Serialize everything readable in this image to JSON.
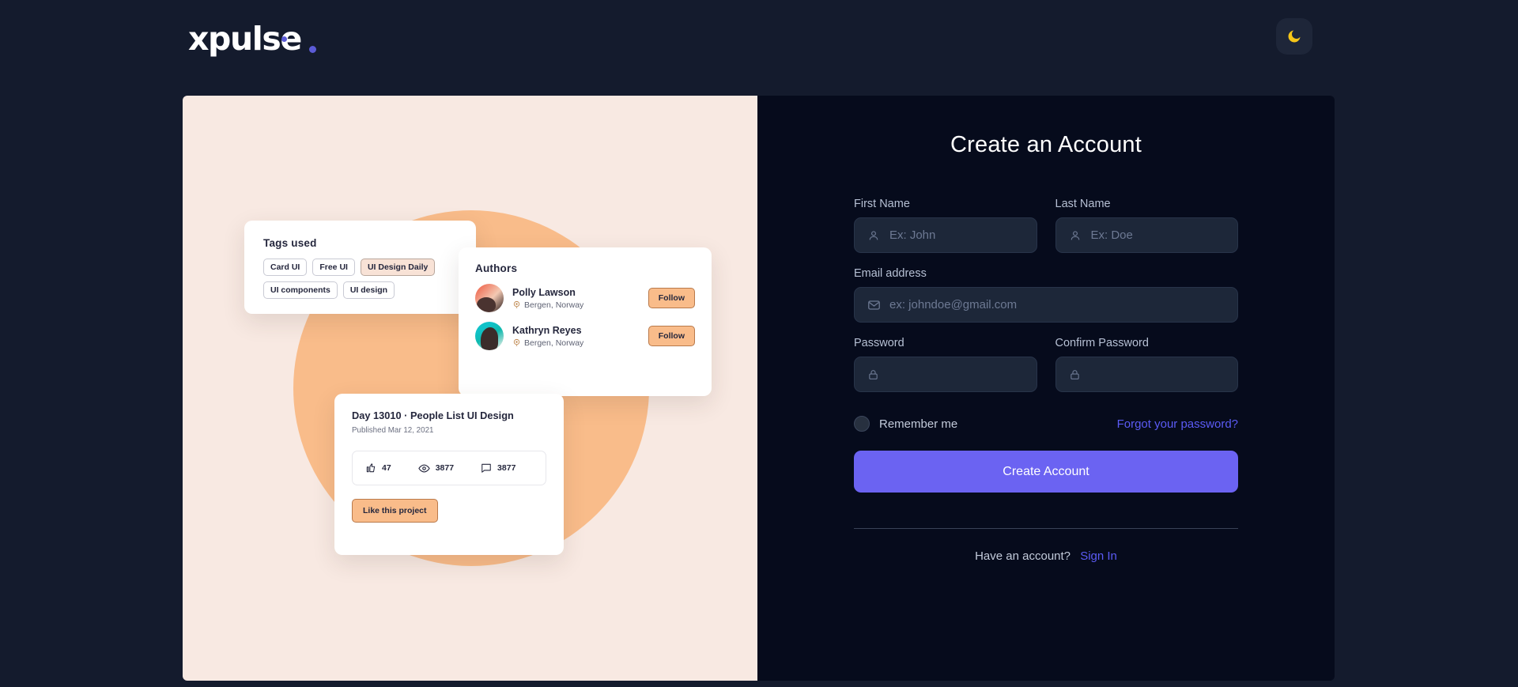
{
  "brand": {
    "name": "xpulse",
    "accent_color": "#5b5bd6"
  },
  "topbar": {
    "theme_toggle_icon": "moon-icon",
    "theme_toggle_color": "#f5c518"
  },
  "illustration": {
    "background_color": "#f8e9e2",
    "blob_color": "#f9bc8a",
    "tags_card": {
      "title": "Tags used",
      "tags": [
        "Card UI",
        "Free UI",
        "UI Design Daily",
        "UI components",
        "UI design"
      ],
      "active_tag": "UI Design Daily"
    },
    "authors_card": {
      "title": "Authors",
      "authors": [
        {
          "name": "Polly Lawson",
          "location": "Bergen, Norway",
          "action": "Follow"
        },
        {
          "name": "Kathryn Reyes",
          "location": "Bergen, Norway",
          "action": "Follow"
        }
      ]
    },
    "project_card": {
      "title": "Day 13010 · People List UI Design",
      "published": "Published Mar 12, 2021",
      "stats": [
        {
          "icon": "thumbs-up-icon",
          "value": "47"
        },
        {
          "icon": "eye-icon",
          "value": "3877"
        },
        {
          "icon": "comment-icon",
          "value": "3877"
        }
      ],
      "like_button": "Like this project"
    }
  },
  "form": {
    "title": "Create an Account",
    "fields": {
      "first_name": {
        "label": "First Name",
        "placeholder": "Ex: John",
        "value": "",
        "icon": "user-icon"
      },
      "last_name": {
        "label": "Last Name",
        "placeholder": "Ex: Doe",
        "value": "",
        "icon": "user-icon"
      },
      "email": {
        "label": "Email address",
        "placeholder": "ex: johndoe@gmail.com",
        "value": "",
        "icon": "mail-icon"
      },
      "password": {
        "label": "Password",
        "placeholder": "",
        "value": "",
        "icon": "lock-icon"
      },
      "confirm_password": {
        "label": "Confirm Password",
        "placeholder": "",
        "value": "",
        "icon": "lock-icon"
      }
    },
    "remember_me": "Remember me",
    "forgot_password": "Forgot your password?",
    "submit": "Create Account",
    "footer_text": "Have an account?",
    "footer_link": "Sign In",
    "accent_color": "#6b63f2",
    "link_color": "#5b5bf5"
  }
}
